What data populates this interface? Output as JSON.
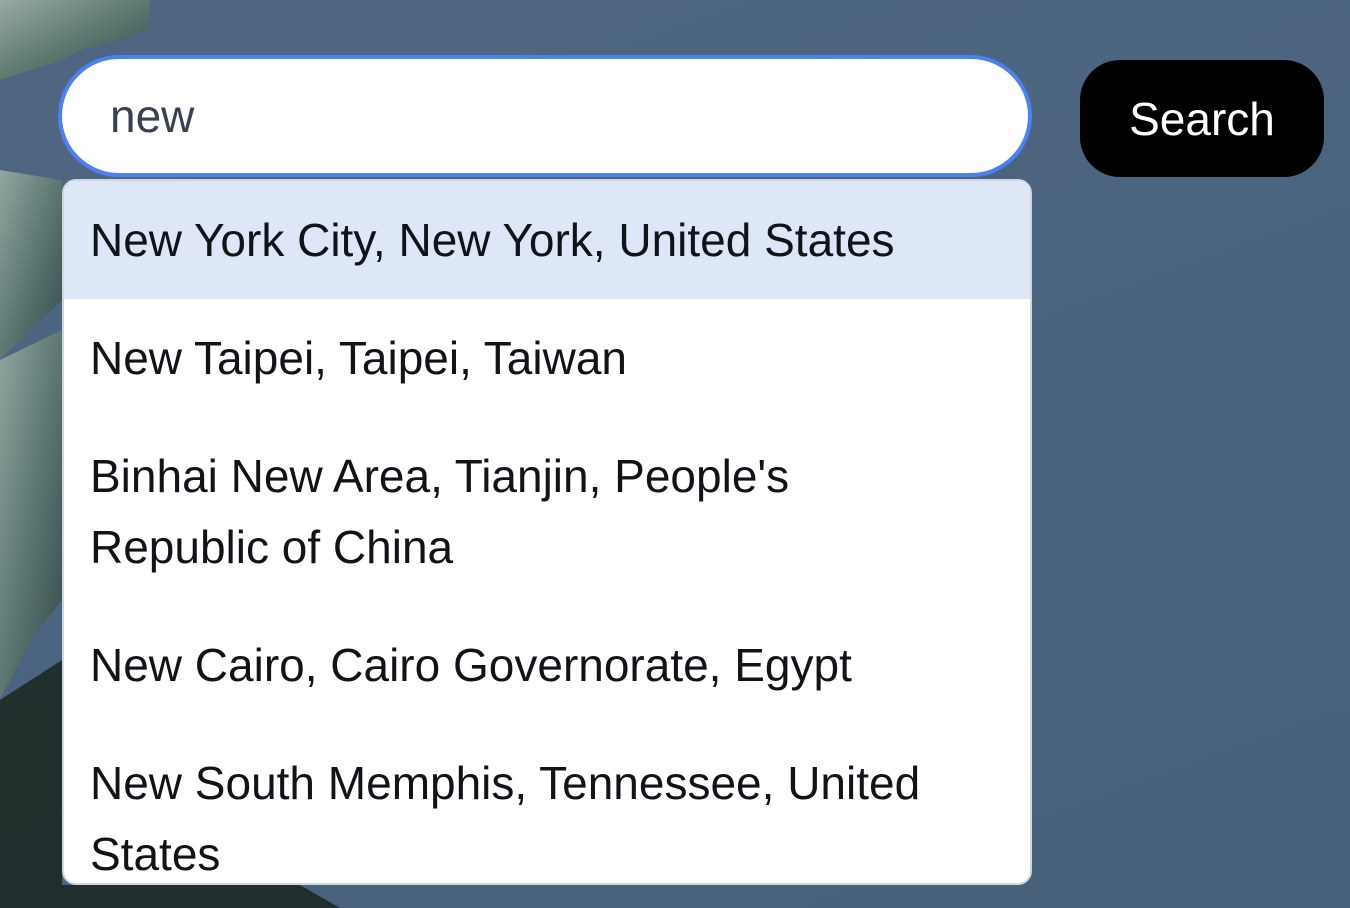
{
  "search": {
    "value": "new",
    "button_label": "Search"
  },
  "suggestions": [
    {
      "label": "New York City, New York, United States",
      "highlighted": true
    },
    {
      "label": "New Taipei, Taipei, Taiwan",
      "highlighted": false
    },
    {
      "label": "Binhai New Area, Tianjin, People's Republic of China",
      "highlighted": false
    },
    {
      "label": "New Cairo, Cairo Governorate, Egypt",
      "highlighted": false
    },
    {
      "label": "New South Memphis, Tennessee, United States",
      "highlighted": false
    }
  ],
  "colors": {
    "input_focus_border": "#4c82f0",
    "highlight_row": "#dde7f8",
    "button_bg": "#000000"
  }
}
